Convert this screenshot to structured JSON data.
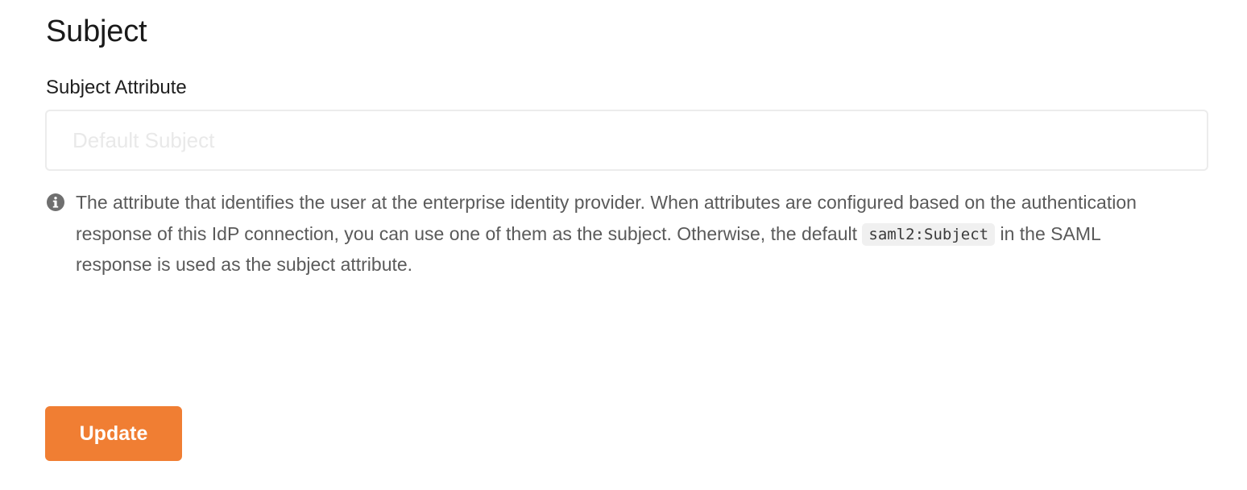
{
  "section": {
    "title": "Subject"
  },
  "subject_attribute": {
    "label": "Subject Attribute",
    "value": "",
    "placeholder": "Default Subject"
  },
  "help": {
    "icon": "info-icon",
    "text_before": "The attribute that identifies the user at the enterprise identity provider. When attributes are configured based on the authentication response of this IdP connection, you can use one of them as the subject. Otherwise, the default ",
    "code": "saml2:Subject",
    "text_after": " in the SAML response is used as the subject attribute."
  },
  "actions": {
    "update_label": "Update"
  },
  "colors": {
    "accent": "#f07e33",
    "help_text": "#5a5a5a"
  }
}
